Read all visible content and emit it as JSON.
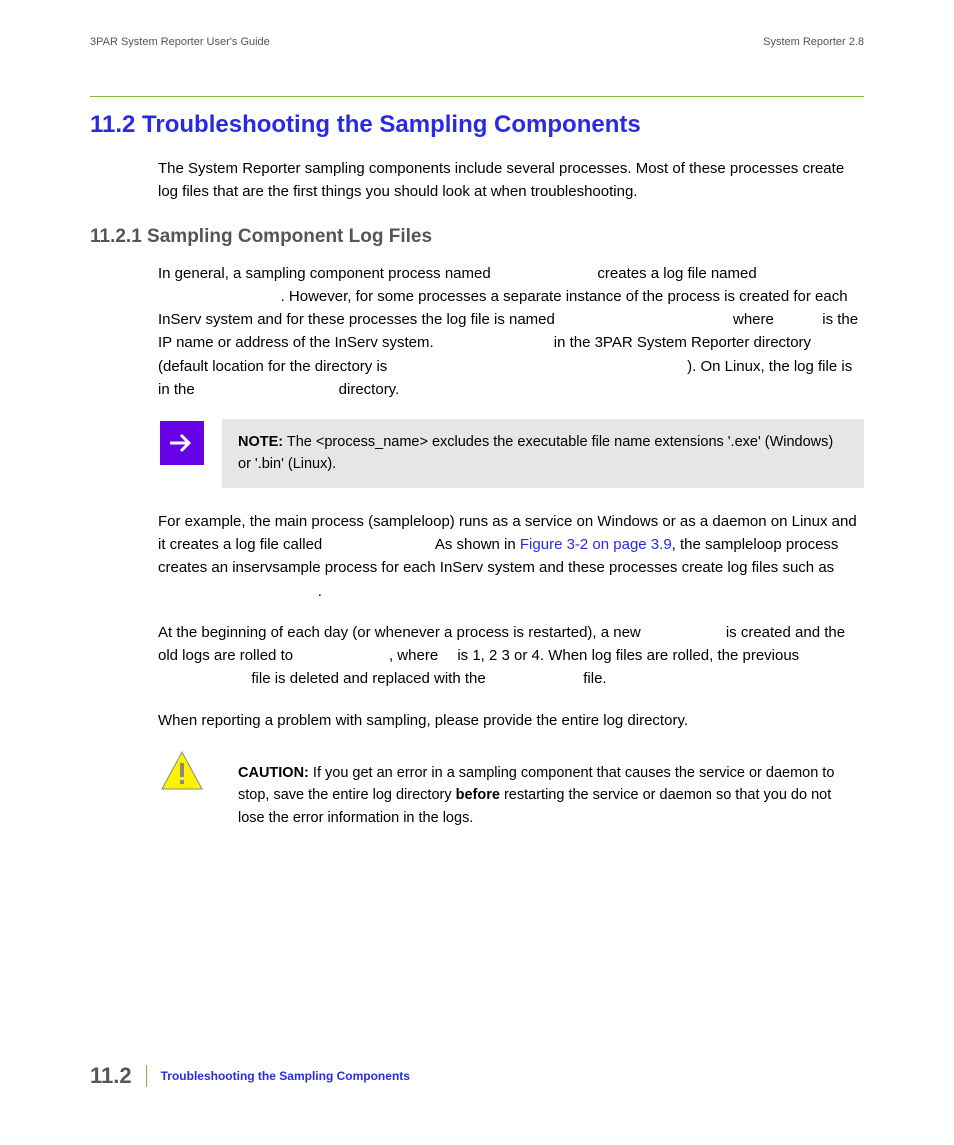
{
  "header": {
    "left": "3PAR System Reporter User's Guide",
    "right": "System Reporter 2.8"
  },
  "section": {
    "number": "11.2",
    "heading": "11.2 Troubleshooting the Sampling Components",
    "intro": "The System Reporter sampling components include several processes. Most of these processes create log files that are the first things you should look at when troubleshooting."
  },
  "subsection": {
    "heading": "11.2.1 Sampling Component Log Files",
    "para1_parts": {
      "a": "In general, a sampling component process named ",
      "b": " creates a log file named ",
      "c": ". However, for some processes a separate instance of the process is created for each InServ system and for these processes the log file is named ",
      "d": " where ",
      "e": " is the IP name or address of the InServ system. ",
      "f": " in the 3PAR System Reporter directory (default location for the directory is ",
      "g": "). On Linux, the log file is in the ",
      "h": " directory."
    },
    "note_label": "NOTE:",
    "note_text": " The <process_name> excludes the executable file name extensions '.exe' (Windows) or '.bin' (Linux).",
    "para2_parts": {
      "a": "For example, the main process (sampleloop) runs as a service on Windows or as a daemon on Linux and it creates a log file called ",
      "b": " As shown in ",
      "link": "Figure 3-2 on page 3.9",
      "c": ", the sampleloop process creates an inservsample process for each InServ system and these processes create log files such as ",
      "d": "."
    },
    "para3_parts": {
      "a": "At the beginning of each day (or whenever a process is restarted), a new ",
      "b": " is created and the old logs are rolled to ",
      "c": ", where ",
      "d": " is 1, 2 3 or 4. When log files are rolled, the previous ",
      "e": " file is deleted and replaced with the ",
      "f": " file."
    },
    "para4": "When reporting a problem with sampling, please provide the entire log directory.",
    "caution_label": "CAUTION:",
    "caution_a": " If you get an error in a sampling component that causes the service or daemon to stop, save the entire log directory ",
    "caution_bold": "before",
    "caution_b": " restarting the service or daemon so that you do not lose the error information in the logs."
  },
  "footer": {
    "page": "11.2",
    "title": "Troubleshooting the Sampling Components"
  }
}
